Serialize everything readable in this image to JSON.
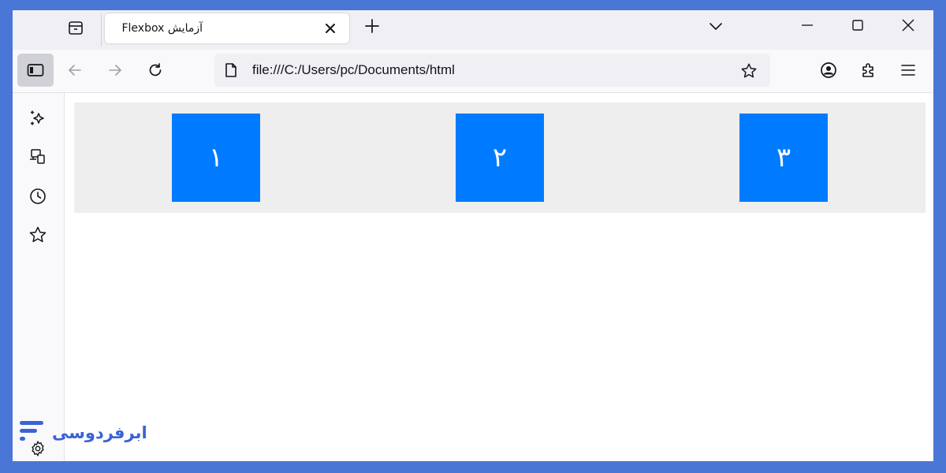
{
  "tab": {
    "title": "آزمایش Flexbox"
  },
  "urlbar": {
    "url": "file:///C:/Users/pc/Documents/html"
  },
  "flex_items": [
    "١",
    "٢",
    "٣"
  ],
  "brand": {
    "name": "ابرفردوسی"
  },
  "colors": {
    "frame": "#4a76d6",
    "item": "#007bff",
    "container": "#eeeeee",
    "toolbar": "#f9f9fb",
    "tabstrip": "#f0f0f4"
  },
  "icons": {
    "tabgroup": "tab-group-icon",
    "tab_close": "close-icon",
    "new_tab": "plus-icon",
    "tab_list": "chevron-down-icon",
    "minimize": "minimize-icon",
    "maximize": "maximize-icon",
    "close_window": "close-icon",
    "sidebar": "sidebar-icon",
    "back": "back-arrow-icon",
    "forward": "forward-arrow-icon",
    "reload": "reload-icon",
    "page": "page-icon",
    "bookmark": "star-icon",
    "account": "account-icon",
    "extensions": "puzzle-icon",
    "menu": "hamburger-menu-icon",
    "ai": "sparkle-icon",
    "synced": "synced-tabs-icon",
    "history": "clock-icon",
    "bookmarks": "star-icon",
    "customize": "gear-icon"
  }
}
